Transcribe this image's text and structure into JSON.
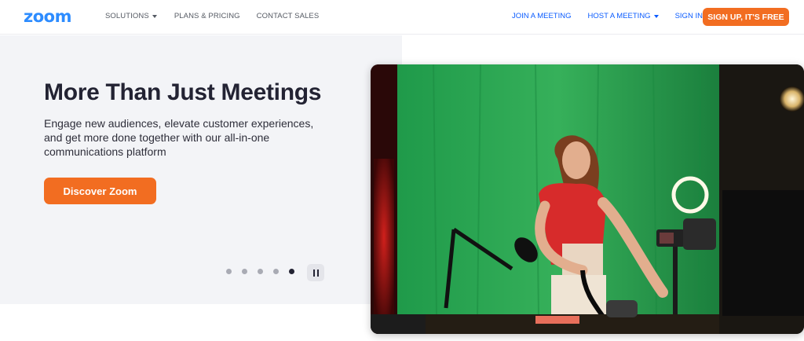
{
  "brand": {
    "logo_text": "zoom",
    "accent": "#2d8cff",
    "cta_color": "#f26d21",
    "link_color": "#0b5cff"
  },
  "nav": {
    "left": [
      {
        "label": "SOLUTIONS",
        "has_caret": true
      },
      {
        "label": "PLANS & PRICING",
        "has_caret": false
      },
      {
        "label": "CONTACT SALES",
        "has_caret": false
      }
    ],
    "right": [
      {
        "label": "JOIN A MEETING",
        "has_caret": false
      },
      {
        "label": "HOST A MEETING",
        "has_caret": true
      },
      {
        "label": "SIGN IN",
        "has_caret": false
      }
    ],
    "signup_label": "SIGN UP, IT'S FREE"
  },
  "hero": {
    "headline": "More Than Just Meetings",
    "subhead": "Engage new audiences, elevate customer experiences, and get more done together with our all-in-one communications platform",
    "cta_label": "Discover Zoom"
  },
  "carousel": {
    "slide_count": 5,
    "active_slide": 5,
    "pause_icon": "pause-icon"
  }
}
